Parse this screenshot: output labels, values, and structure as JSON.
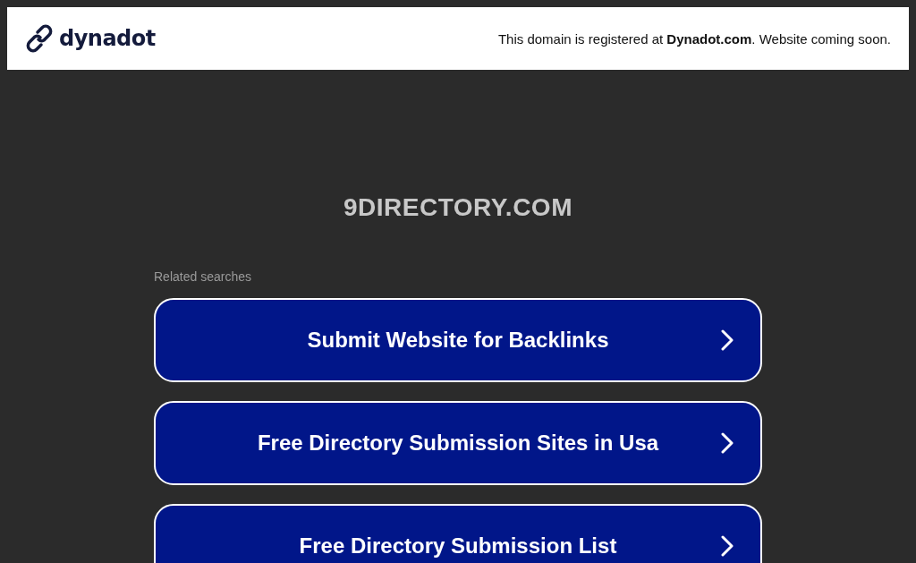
{
  "header": {
    "brand": "dynadot",
    "notice": "This domain is registered at **Dynadot.com**. Website coming soon."
  },
  "domain": "9DIRECTORY.COM",
  "related": {
    "label": "Related searches",
    "items": [
      {
        "label": "Submit Website for Backlinks"
      },
      {
        "label": "Free Directory Submission Sites in Usa"
      },
      {
        "label": "Free Directory Submission List"
      }
    ]
  }
}
